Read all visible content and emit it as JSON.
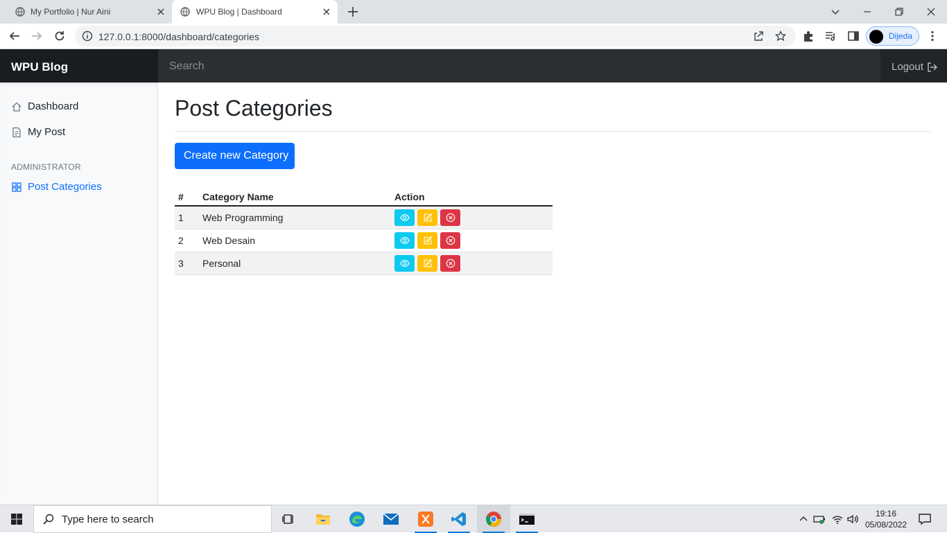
{
  "browser": {
    "tabs": [
      {
        "title": "My Portfolio | Nur Aini",
        "active": false
      },
      {
        "title": "WPU Blog | Dashboard",
        "active": true
      }
    ],
    "url": "127.0.0.1:8000/dashboard/categories",
    "profile_name": "Dijeda"
  },
  "navbar": {
    "brand": "WPU Blog",
    "search_placeholder": "Search",
    "logout_label": "Logout"
  },
  "sidebar": {
    "items": [
      {
        "label": "Dashboard",
        "icon": "home-icon"
      },
      {
        "label": "My Post",
        "icon": "file-text-icon"
      }
    ],
    "admin_heading": "ADMINISTRATOR",
    "admin_items": [
      {
        "label": "Post Categories",
        "icon": "grid-icon",
        "active": true
      }
    ]
  },
  "main": {
    "title": "Post Categories",
    "create_button": "Create new Category",
    "table": {
      "headers": [
        "#",
        "Category Name",
        "Action"
      ],
      "rows": [
        {
          "num": "1",
          "name": "Web Programming"
        },
        {
          "num": "2",
          "name": "Web Desain"
        },
        {
          "num": "3",
          "name": "Personal"
        }
      ]
    },
    "colors": {
      "view": "#0dcaf0",
      "edit": "#ffc107",
      "delete": "#dc3545",
      "primary": "#0d6efd"
    }
  },
  "taskbar": {
    "search_placeholder": "Type here to search",
    "time": "19:16",
    "date": "05/08/2022"
  }
}
